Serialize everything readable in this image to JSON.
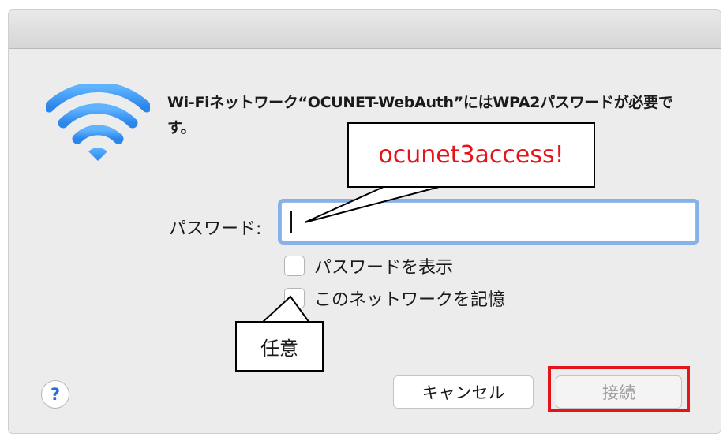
{
  "dialog": {
    "message": "Wi-Fiネットワーク“OCUNET-WebAuth”にはWPA2パスワードが必要です。",
    "password_label": "パスワード:",
    "password_value": "",
    "show_password_label": "パスワードを表示",
    "show_password_checked": false,
    "remember_network_label": "このネットワークを記憶",
    "remember_network_checked": false,
    "help_label": "?",
    "cancel_label": "キャンセル",
    "connect_label": "接続",
    "connect_enabled": false
  },
  "annotations": {
    "password_hint": "ocunet3access!",
    "optional_label": "任意"
  },
  "colors": {
    "accent": "#86b2ea",
    "wifi_icon": "#3a95f0",
    "highlight_red": "#e5141a"
  },
  "icons": {
    "wifi": "wifi-icon",
    "help": "help-icon"
  }
}
